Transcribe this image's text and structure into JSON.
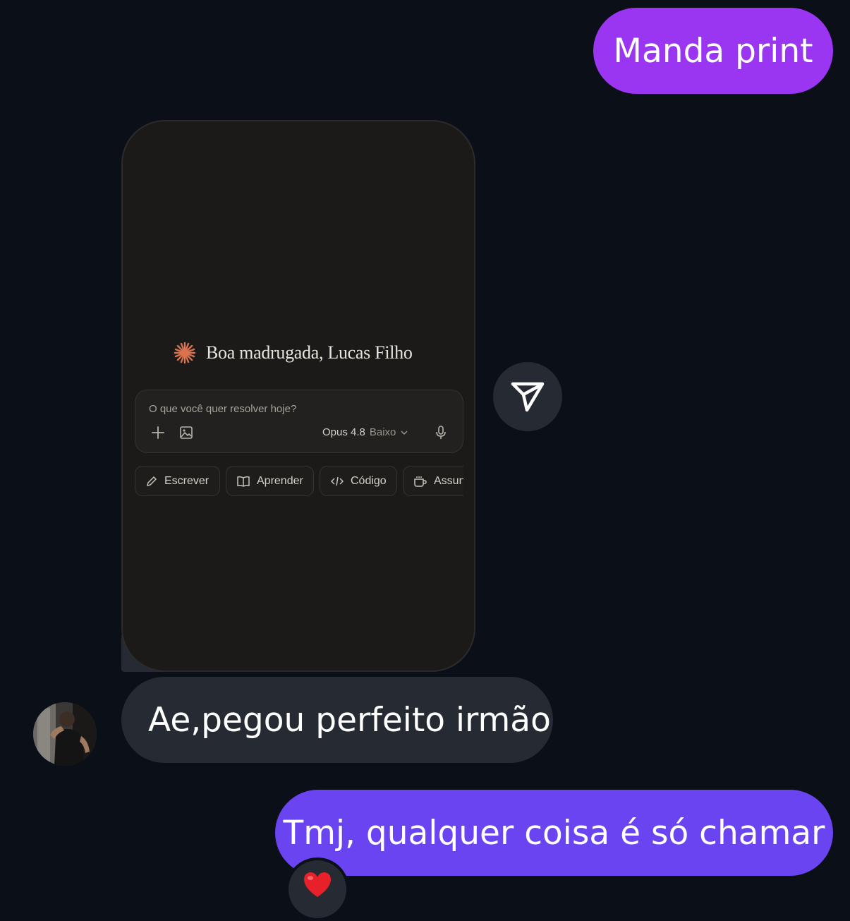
{
  "messages": {
    "sent_1": "Manda print",
    "received_1": "Ae,pegou perfeito irmão",
    "sent_2": "Tmj, qualquer coisa é só chamar"
  },
  "screenshot": {
    "greeting": "Boa madrugada, Lucas Filho",
    "composer_placeholder": "O que você quer resolver hoje?",
    "model_name": "Opus 4.8",
    "model_level": "Baixo",
    "chips": [
      "Escrever",
      "Aprender",
      "Código",
      "Assun"
    ]
  },
  "reaction": {
    "emoji": "❤️"
  },
  "colors": {
    "background": "#0b0f18",
    "sent_bubble_1": "#9a35f2",
    "sent_bubble_2": "#6a44f0",
    "received_bubble": "#262a32",
    "brand_star": "#d9734f"
  },
  "icons": [
    "plus-icon",
    "image-icon",
    "chevron-down-icon",
    "microphone-icon",
    "pencil-icon",
    "book-icon",
    "code-icon",
    "coffee-icon",
    "share-icon",
    "heart-icon",
    "sparkle-logo-icon"
  ]
}
